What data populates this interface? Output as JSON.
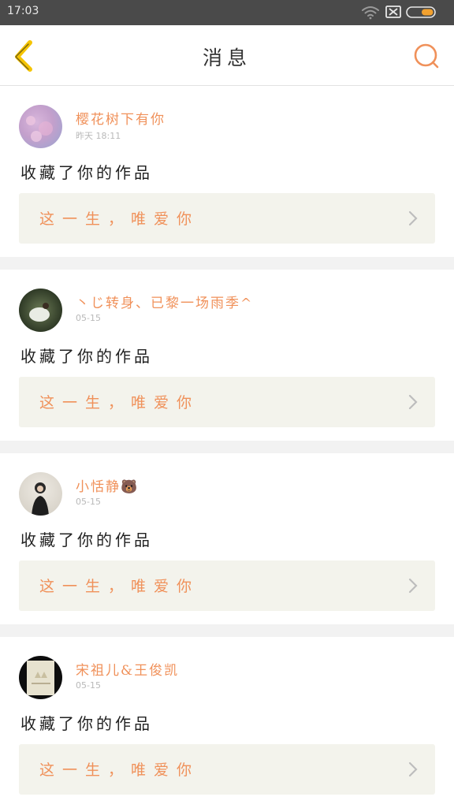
{
  "status_bar": {
    "time": "17:03",
    "icons": [
      "wifi-icon",
      "sim-none-icon",
      "battery-icon"
    ]
  },
  "nav": {
    "title": "消息",
    "back_icon": "chevron-left-icon",
    "search_icon": "search-icon"
  },
  "colors": {
    "accent": "#f0915a",
    "back_arrow": "#f5c400",
    "status_bg": "#4a4a4a",
    "work_bg": "#f3f3ec",
    "divider": "#f2f2f2"
  },
  "messages": [
    {
      "username": "樱花树下有你",
      "time": "昨天 18:11",
      "action": "收藏了你的作品",
      "work_title": "这一生，唯爱你"
    },
    {
      "username": "丶じ转身、已黎一场雨季^",
      "time": "05-15",
      "action": "收藏了你的作品",
      "work_title": "这一生，唯爱你"
    },
    {
      "username": "小恬静🐻",
      "time": "05-15",
      "action": "收藏了你的作品",
      "work_title": "这一生，唯爱你"
    },
    {
      "username": "宋祖儿&王俊凯",
      "time": "05-15",
      "action": "收藏了你的作品",
      "work_title": "这一生，唯爱你"
    }
  ]
}
